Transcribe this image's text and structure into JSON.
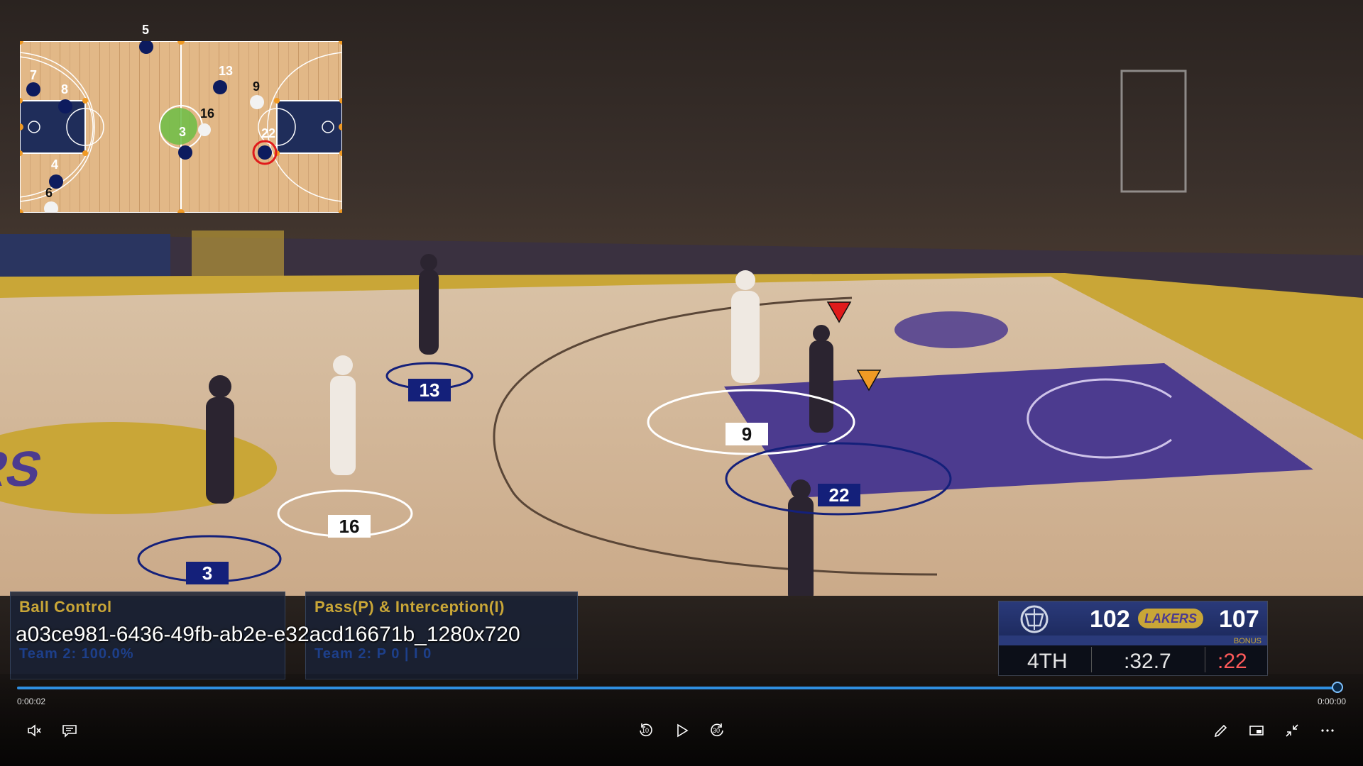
{
  "overlay": {
    "player_tags": [
      {
        "id": "tag-13",
        "label": "13",
        "style": "navy"
      },
      {
        "id": "tag-9",
        "label": "9",
        "style": "white"
      },
      {
        "id": "tag-22",
        "label": "22",
        "style": "navy"
      },
      {
        "id": "tag-16",
        "label": "16",
        "style": "white"
      },
      {
        "id": "tag-3",
        "label": "3",
        "style": "navy"
      }
    ],
    "minimap_labels": [
      "5",
      "7",
      "8",
      "13",
      "9",
      "16",
      "3",
      "22",
      "4",
      "6"
    ]
  },
  "stats": {
    "ball_control": {
      "title": "Ball Control",
      "line2": "Team 2: 100.0%"
    },
    "pass_interception": {
      "title": "Pass(P) & Interception(I)",
      "line2": "Team 2: P 0 | I 0"
    }
  },
  "caption": "a03ce981-6436-49fb-ab2e-e32acd16671b_1280x720",
  "scoreboard": {
    "away_score": "102",
    "home_score": "107",
    "home_logo_text": "LAKERS",
    "bonus": "BONUS",
    "quarter": "4TH",
    "game_clock": ":32.7",
    "shot_clock": ":22"
  },
  "player": {
    "time_elapsed": "0:00:02",
    "time_remaining": "0:00:00",
    "progress_percent": 100,
    "rewind_label": "10",
    "forward_label": "30"
  }
}
